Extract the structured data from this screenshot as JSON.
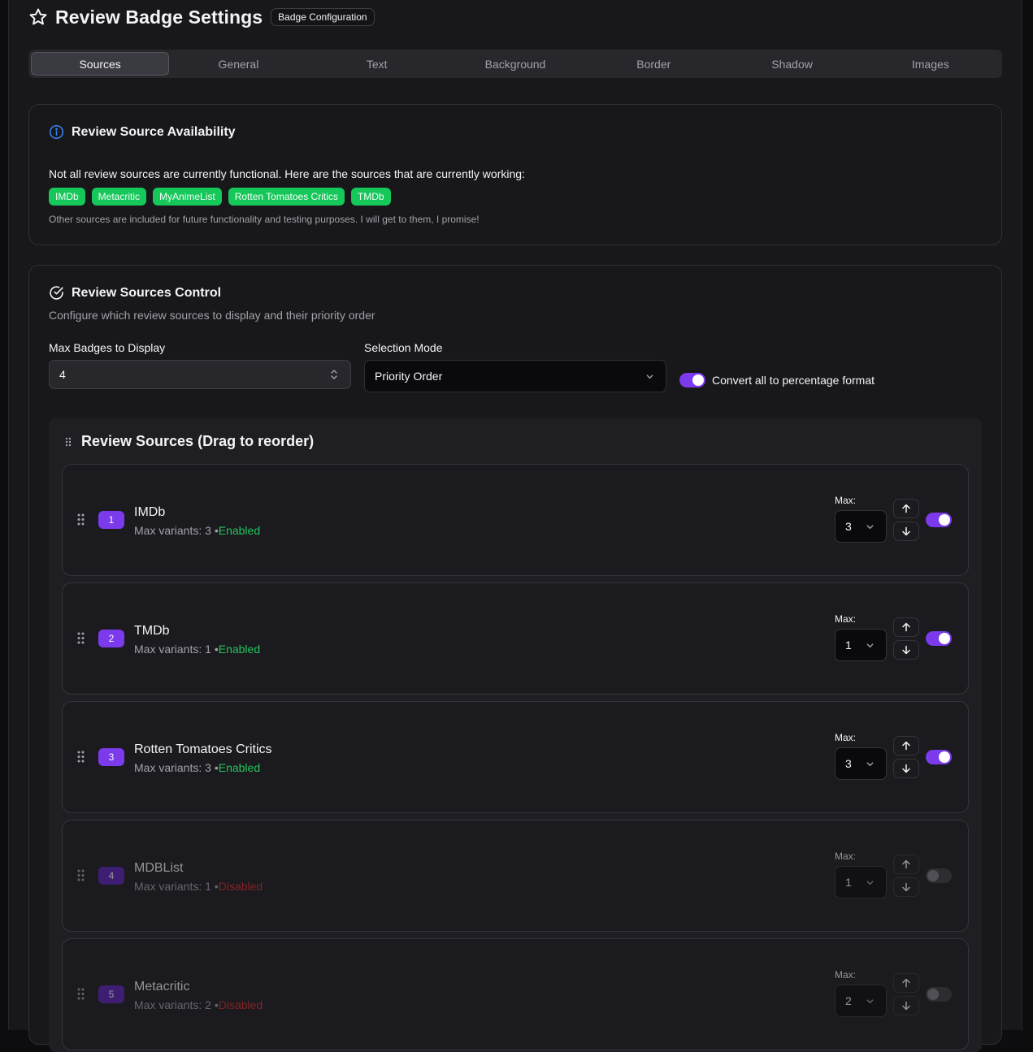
{
  "header": {
    "title": "Review Badge Settings",
    "badge": "Badge Configuration"
  },
  "tabs": [
    "Sources",
    "General",
    "Text",
    "Background",
    "Border",
    "Shadow",
    "Images"
  ],
  "availability": {
    "title": "Review Source Availability",
    "text": "Not all review sources are currently functional. Here are the sources that are currently working:",
    "working": [
      "IMDb",
      "Metacritic",
      "MyAnimeList",
      "Rotten Tomatoes Critics",
      "TMDb"
    ],
    "note": "Other sources are included for future functionality and testing purposes. I will get to them, I promise!"
  },
  "control": {
    "title": "Review Sources Control",
    "subtitle": "Configure which review sources to display and their priority order",
    "max_badges_label": "Max Badges to Display",
    "max_badges_value": "4",
    "selection_mode_label": "Selection Mode",
    "selection_mode_value": "Priority Order",
    "percentage_label": "Convert all to percentage format",
    "percentage_enabled": true
  },
  "sources_list": {
    "title": "Review Sources (Drag to reorder)",
    "max_label": "Max:",
    "variants_prefix": "Max variants: ",
    "items": [
      {
        "rank": "1",
        "name": "IMDb",
        "variants": "3",
        "status": "Enabled",
        "max": "3",
        "enabled": true
      },
      {
        "rank": "2",
        "name": "TMDb",
        "variants": "1",
        "status": "Enabled",
        "max": "1",
        "enabled": true
      },
      {
        "rank": "3",
        "name": "Rotten Tomatoes Critics",
        "variants": "3",
        "status": "Enabled",
        "max": "3",
        "enabled": true
      },
      {
        "rank": "4",
        "name": "MDBList",
        "variants": "1",
        "status": "Disabled",
        "max": "1",
        "enabled": false
      },
      {
        "rank": "5",
        "name": "Metacritic",
        "variants": "2",
        "status": "Disabled",
        "max": "2",
        "enabled": false
      }
    ]
  },
  "colors": {
    "accent": "#7c3aed",
    "success": "#16c75a",
    "danger": "#dc2626",
    "info": "#3b82f6"
  }
}
